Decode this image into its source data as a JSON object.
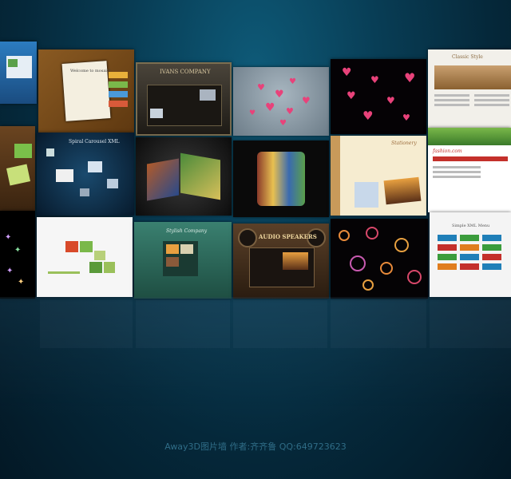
{
  "credit": "Away3D图片墙   作者:齐齐鲁   QQ:649723623",
  "tiles": {
    "r1c2": {
      "caption": "Welcome to mosaic!",
      "accent": "#f28c28"
    },
    "r1c3": {
      "caption": "IVANS COMPANY"
    },
    "r1c6": {
      "caption": "Classic Style"
    },
    "r2c2": {
      "caption": "Spiral Carousel XML"
    },
    "r2c5": {
      "caption": "Stationery"
    },
    "r2c6": {
      "caption": "fashion.com"
    },
    "r3c3": {
      "caption": "Stylish Company"
    },
    "r3c4": {
      "caption": "AUDIO SPEAKERS"
    },
    "r3c6": {
      "caption": "Simple XML Menu"
    }
  },
  "colors": {
    "background": "#083d55",
    "heart": "#e8427a",
    "menu_blue": "#1f7fb8",
    "menu_red": "#c4302b",
    "menu_green": "#3b9c3c",
    "menu_orange": "#e07d1e"
  }
}
